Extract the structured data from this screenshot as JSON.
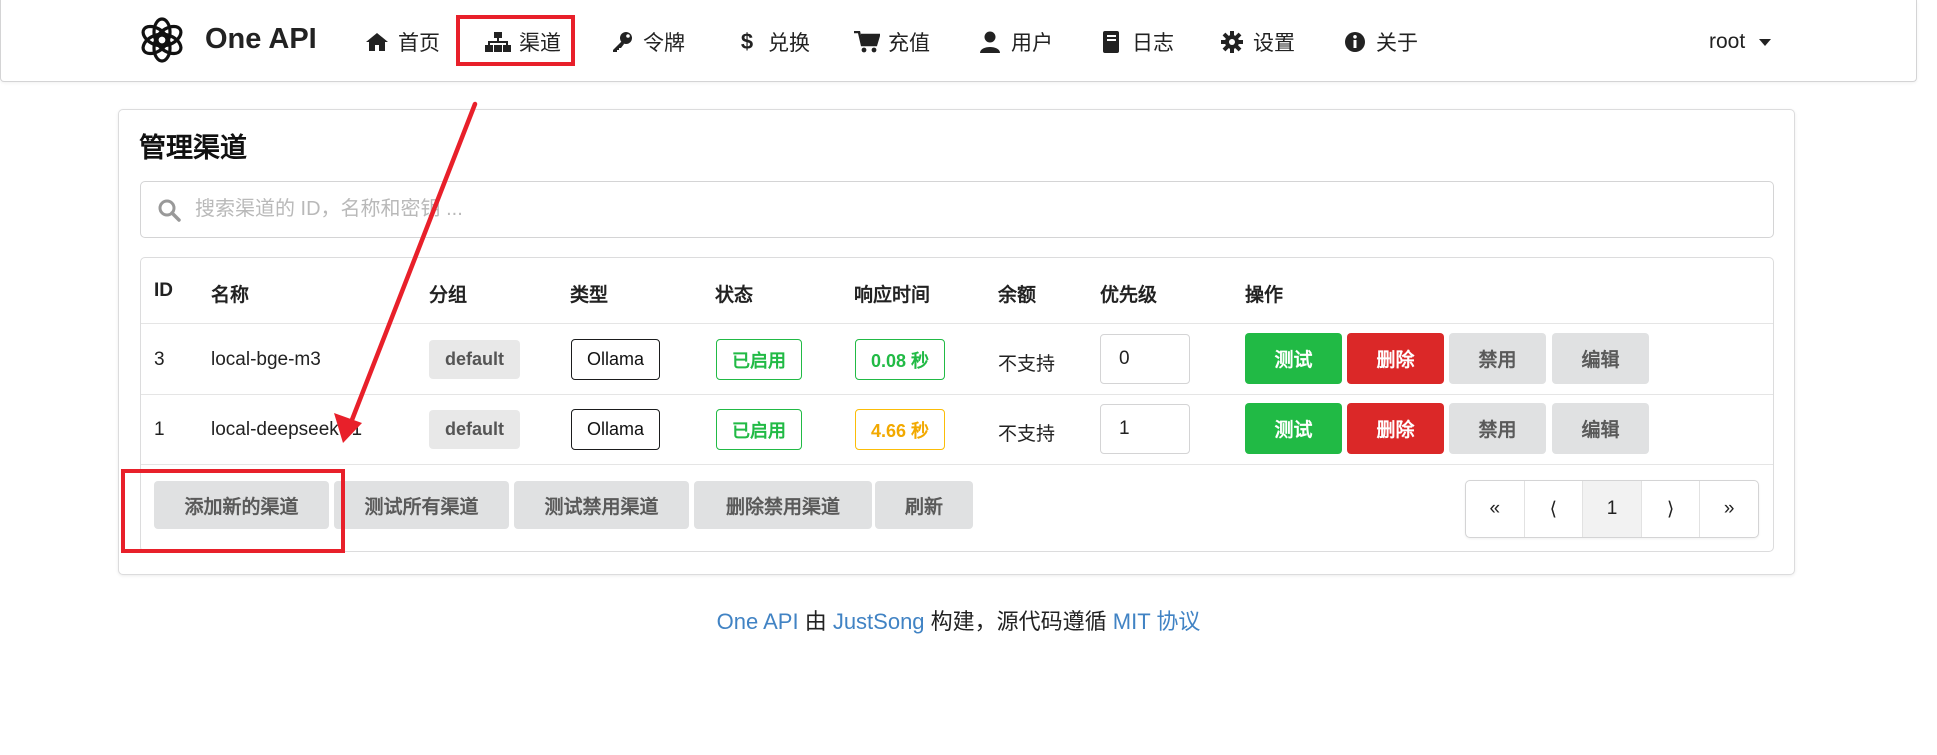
{
  "app": {
    "brand": "One API"
  },
  "nav": {
    "items": [
      {
        "label": "首页",
        "icon": "home-icon"
      },
      {
        "label": "渠道",
        "icon": "sitemap-icon"
      },
      {
        "label": "令牌",
        "icon": "key-icon"
      },
      {
        "label": "兑换",
        "icon": "dollar-icon"
      },
      {
        "label": "充值",
        "icon": "cart-icon"
      },
      {
        "label": "用户",
        "icon": "user-icon"
      },
      {
        "label": "日志",
        "icon": "book-icon"
      },
      {
        "label": "设置",
        "icon": "gear-icon"
      },
      {
        "label": "关于",
        "icon": "info-icon"
      }
    ],
    "user": "root"
  },
  "page": {
    "title": "管理渠道",
    "search_placeholder": "搜索渠道的 ID，名称和密钥 ..."
  },
  "table": {
    "headers": [
      "ID",
      "名称",
      "分组",
      "类型",
      "状态",
      "响应时间",
      "余额",
      "优先级",
      "操作"
    ],
    "rows": [
      {
        "id": "3",
        "name": "local-bge-m3",
        "group": "default",
        "type": "Ollama",
        "status": "已启用",
        "response": "0.08 秒",
        "response_level": "good",
        "balance": "不支持",
        "priority": "0"
      },
      {
        "id": "1",
        "name": "local-deepseek-r1",
        "group": "default",
        "type": "Ollama",
        "status": "已启用",
        "response": "4.66 秒",
        "response_level": "warn",
        "balance": "不支持",
        "priority": "1"
      }
    ],
    "actions": {
      "test": "测试",
      "delete": "删除",
      "disable": "禁用",
      "edit": "编辑"
    }
  },
  "footer_buttons": {
    "add": "添加新的渠道",
    "test_all": "测试所有渠道",
    "test_disabled": "测试禁用渠道",
    "delete_disabled": "删除禁用渠道",
    "refresh": "刷新"
  },
  "pagination": {
    "first": "«",
    "prev": "⟨",
    "current": "1",
    "next": "⟩",
    "last": "»"
  },
  "footer": {
    "brand_link": "One API",
    "by": " 由 ",
    "author_link": "JustSong",
    "built": " 构建，源代码遵循 ",
    "license_link": "MIT 协议"
  },
  "colors": {
    "annotation": "#e8202a",
    "success": "#21ba45",
    "danger": "#db2828",
    "warning": "#fbbd08",
    "link": "#4183c4"
  }
}
